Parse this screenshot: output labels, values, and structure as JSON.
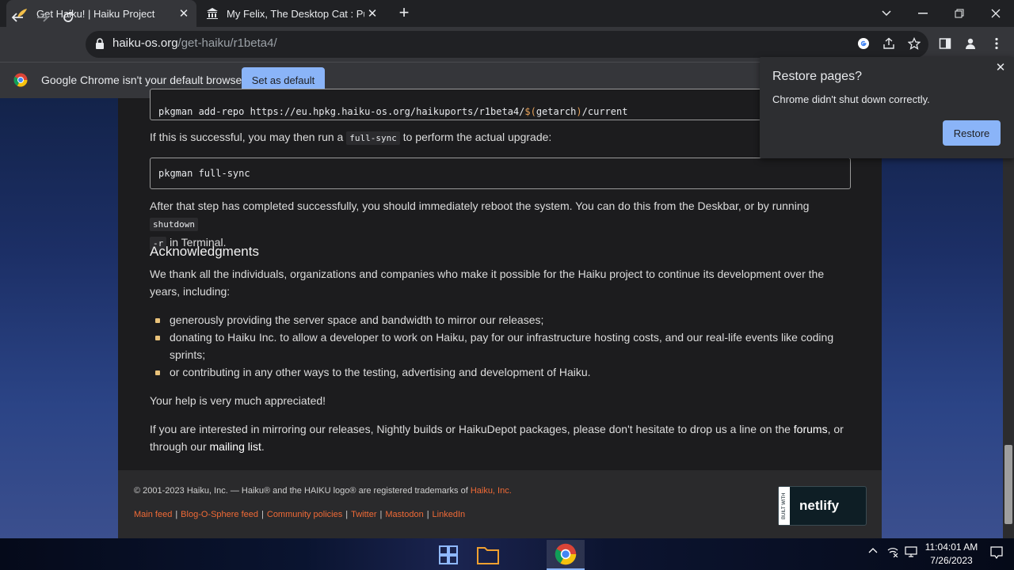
{
  "tabs": [
    {
      "title": "Get Haiku! | Haiku Project",
      "active": true
    },
    {
      "title": "My Felix, The Desktop Cat : Purin",
      "active": false
    }
  ],
  "address": {
    "host": "haiku-os.org",
    "path": "/get-haiku/r1beta4/"
  },
  "infobar": {
    "text": "Google Chrome isn't your default browser",
    "button": "Set as default"
  },
  "popup": {
    "title": "Restore pages?",
    "message": "Chrome didn't shut down correctly.",
    "button": "Restore"
  },
  "content": {
    "code1_prefix": "pkgman add-repo https://eu.hpkg.haiku-os.org/haikuports/r1beta4/",
    "code1_var": "$(",
    "code1_mid": "getarch",
    "code1_close": ")",
    "code1_suffix": "/current",
    "p1_before": "If this is successful, you may then run a ",
    "p1_code": "full-sync",
    "p1_after": " to perform the actual upgrade:",
    "code2": "pkgman full-sync",
    "p2_before": "After that step has completed successfully, you should immediately reboot the system. You can do this from the Deskbar, or by running ",
    "p2_code1": "shutdown",
    "p2_code2": "-r",
    "p2_after": " in Terminal.",
    "heading": "Acknowledgments",
    "p3": "We thank all the individuals, organizations and companies who make it possible for the Haiku project to continue its development over the years, including:",
    "bullets": [
      "generously providing the server space and bandwidth to mirror our releases;",
      "donating to Haiku Inc. to allow a developer to work on Haiku, pay for our infrastructure hosting costs, and our real-life events like coding sprints;",
      "or contributing in any other ways to the testing, advertising and development of Haiku."
    ],
    "p4": "Your help is very much appreciated!",
    "p5_before": "If you are interested in mirroring our releases, Nightly builds or HaikuDepot packages, please don't hesitate to drop us a line on the ",
    "p5_link1": "forums",
    "p5_mid": ", or through our ",
    "p5_link2": "mailing list",
    "p5_after": "."
  },
  "footer": {
    "copyright": "© 2001-2023 Haiku, Inc. — Haiku® and the HAIKU logo® are registered trademarks of ",
    "copyright_link": "Haiku, Inc.",
    "links": [
      "Main feed",
      "Blog-O-Sphere feed",
      "Community policies",
      "Twitter",
      "Mastodon",
      "LinkedIn"
    ],
    "netlify_built": "BUILT WITH",
    "netlify_word": "netlify"
  },
  "clock": {
    "time": "11:04:01 AM",
    "date": "7/26/2023"
  },
  "colors": {
    "accent": "#8ab4f8",
    "link_orange": "#f06a36",
    "bullet": "#e9c27a"
  }
}
